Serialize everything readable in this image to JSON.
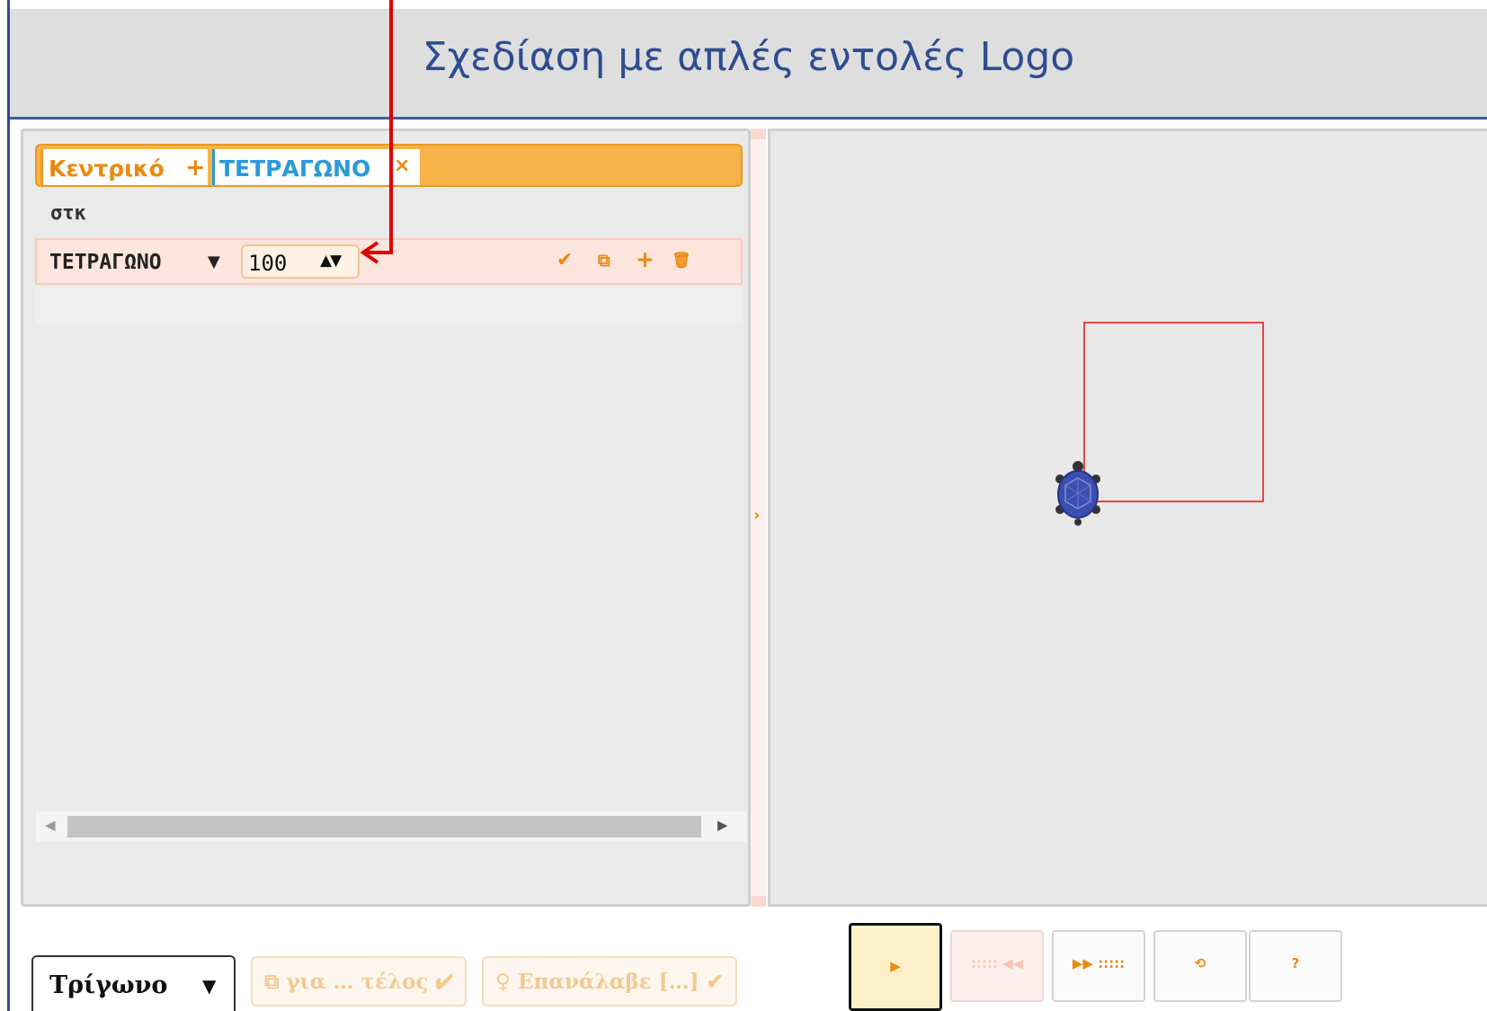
{
  "header": {
    "title": "Σχεδίαση με απλές εντολές Logo"
  },
  "editor": {
    "tabs": [
      {
        "label": "Κεντρικό",
        "action_glyph": "+"
      },
      {
        "label": "ΤΕΤΡΑΓΩΝΟ",
        "action_glyph": "×"
      }
    ],
    "lines": [
      {
        "command": "στκ"
      },
      {
        "command": "ΤΕΤΡΑΓΩΝΟ",
        "dropdown_glyph": "▼",
        "argument": "100",
        "spinner_glyph": "▲▼",
        "actions": [
          "check-icon",
          "copy-icon",
          "plus-icon",
          "trash-icon"
        ],
        "action_glyphs": [
          "✔",
          "⧉",
          "+",
          "🗑"
        ]
      }
    ],
    "scrollbar": {
      "left_glyph": "◀",
      "right_glyph": "▶"
    },
    "splitter_glyph": "›"
  },
  "canvas": {
    "drawing": {
      "shape": "square",
      "side": 100,
      "color": "#ee4444"
    },
    "turtle": {
      "icon": "turtle-icon",
      "color": "#3b4fb0"
    }
  },
  "toolbar": {
    "example_select": {
      "value": "Τρίγωνο",
      "caret": "▼"
    },
    "snippets": [
      {
        "label": "⧉ για … τέλος ✔"
      },
      {
        "label": "♀ Επανάλαβε […] ✔"
      }
    ],
    "controls": [
      {
        "name": "run",
        "glyph": "▶"
      },
      {
        "name": "step-back",
        "glyph": "::::: ◀◀"
      },
      {
        "name": "step-forward",
        "glyph": "▶▶ :::::"
      },
      {
        "name": "reset",
        "glyph": "⟲"
      },
      {
        "name": "help",
        "glyph": "?"
      }
    ]
  },
  "annotation": {
    "color": "#e00000"
  }
}
